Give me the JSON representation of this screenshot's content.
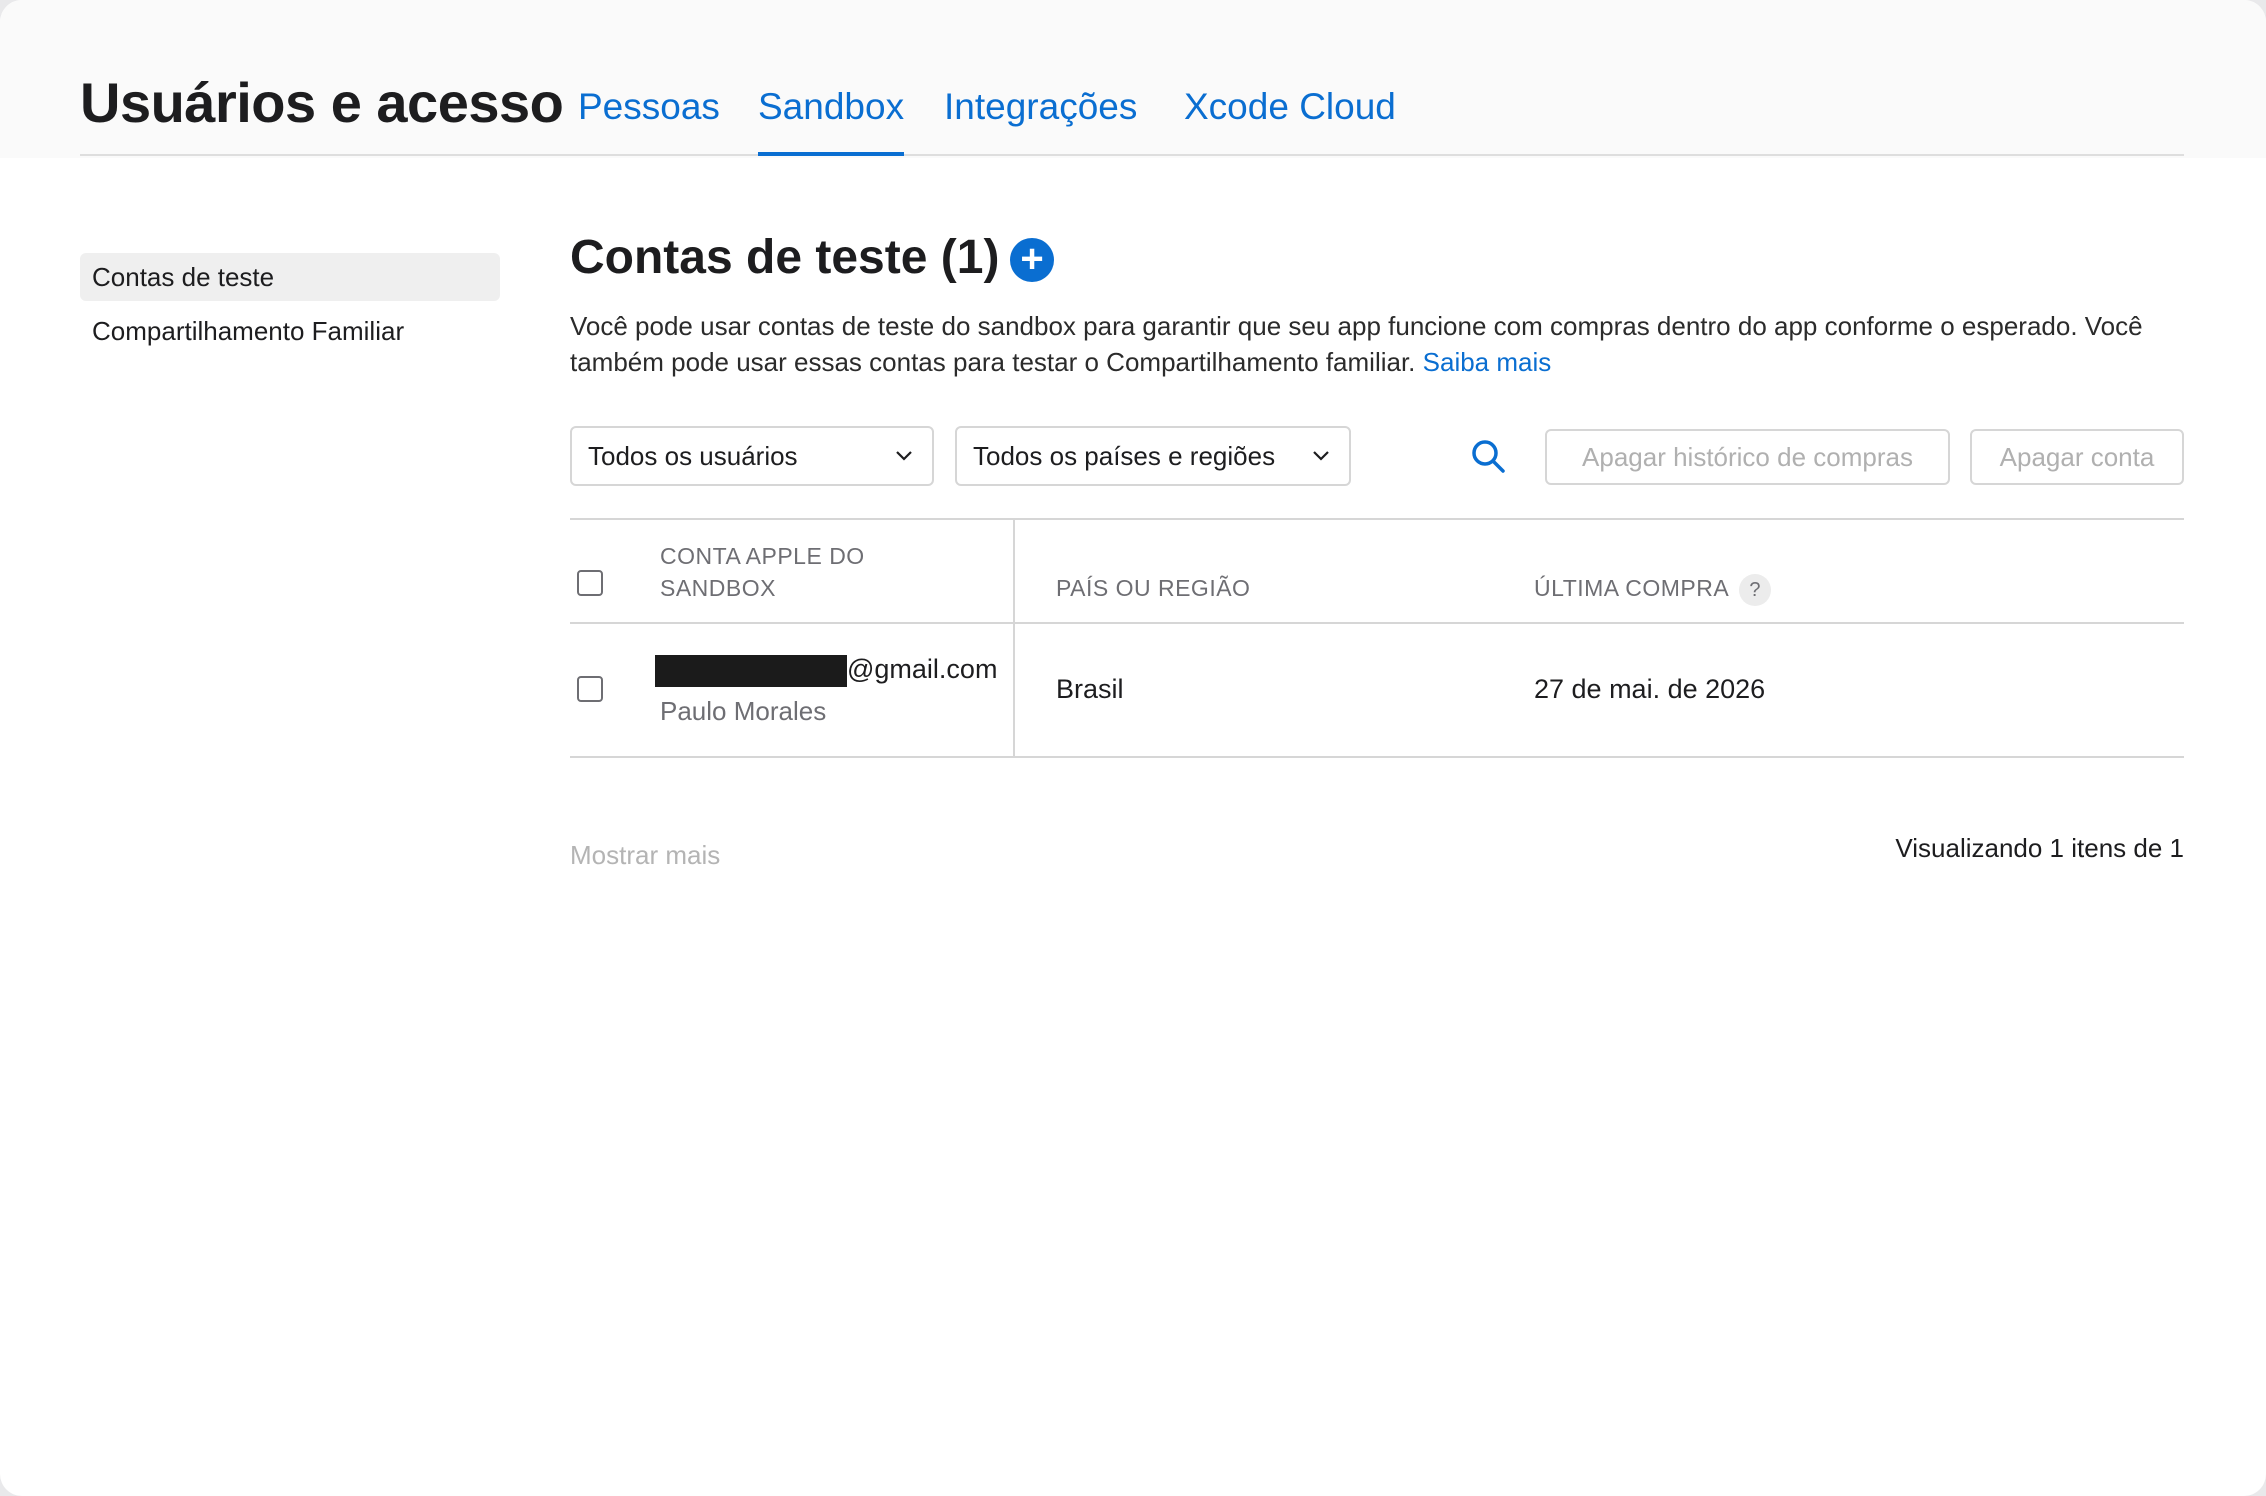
{
  "header": {
    "title": "Usuários e acesso",
    "tabs": [
      {
        "label": "Pessoas"
      },
      {
        "label": "Sandbox"
      },
      {
        "label": "Integrações"
      },
      {
        "label": "Xcode Cloud"
      }
    ],
    "active_tab": "Sandbox"
  },
  "sidebar": {
    "items": [
      {
        "label": "Contas de teste"
      },
      {
        "label": "Compartilhamento Familiar"
      }
    ],
    "active_item": "Contas de teste"
  },
  "main": {
    "title": "Contas de teste (1)",
    "description": "Você pode usar contas de teste do sandbox para garantir que seu app funcione com compras dentro do app conforme o esperado. Você também pode usar essas contas para testar o Compartilhamento familiar.",
    "learn_more": "Saiba mais",
    "filters": {
      "users": "Todos os usuários",
      "regions": "Todos os países e regiões"
    },
    "actions": {
      "clear_history": "Apagar histórico de compras",
      "delete_account": "Apagar conta"
    },
    "table": {
      "columns": [
        "CONTA APPLE DO SANDBOX",
        "PAÍS OU REGIÃO",
        "ÚLTIMA COMPRA"
      ],
      "help_glyph": "?",
      "rows": [
        {
          "email_visible": "@gmail.com",
          "name": "Paulo Morales",
          "country": "Brasil",
          "last_purchase": "27 de mai. de 2026"
        }
      ]
    },
    "show_more": "Mostrar mais",
    "paging": "Visualizando 1 itens de 1"
  },
  "colors": {
    "accent": "#0a6ed1",
    "text": "#1d1d1f",
    "muted": "#6e6e73",
    "border": "#d6d6d6"
  },
  "icons": [
    "plus-circle-icon",
    "chevron-down-icon",
    "search-icon",
    "question-icon"
  ]
}
